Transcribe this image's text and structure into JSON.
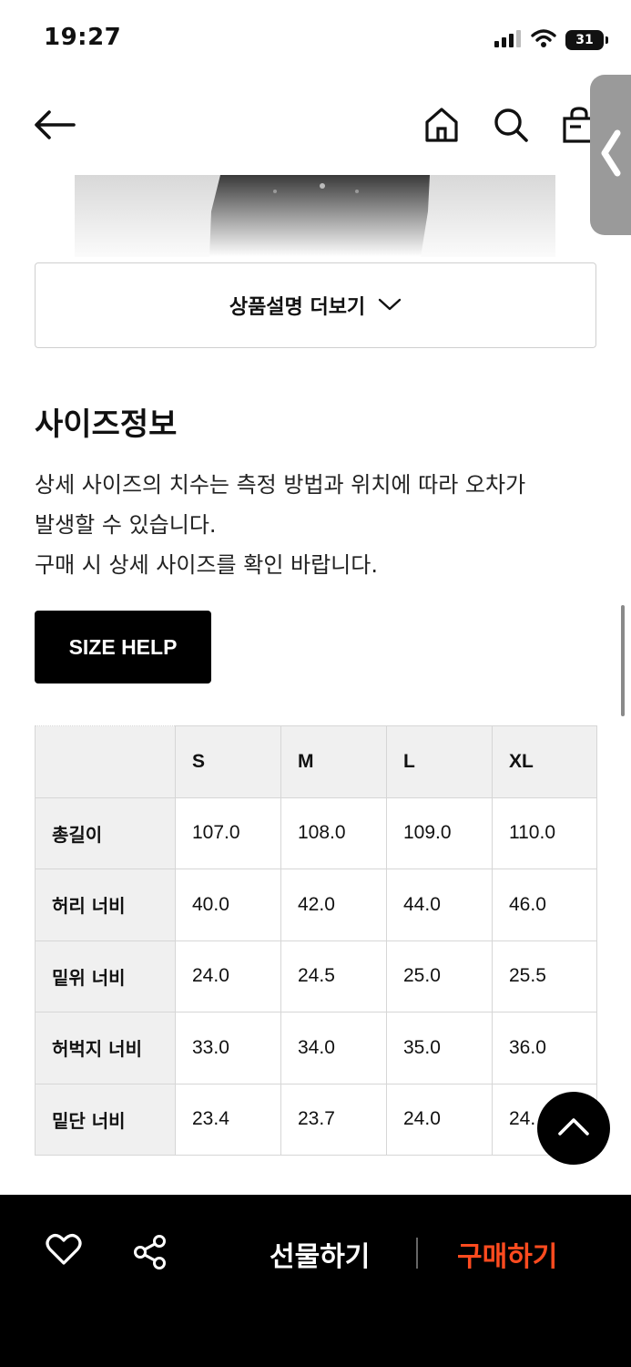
{
  "status_bar": {
    "time": "19:27",
    "battery": "31",
    "icons": [
      "signal-icon",
      "wifi-icon",
      "battery-icon"
    ]
  },
  "nav": {
    "icons": [
      "back-arrow-icon",
      "home-icon",
      "search-icon",
      "shopping-bag-icon",
      "chevron-left-icon"
    ]
  },
  "product": {
    "more_button_label": "상품설명 더보기"
  },
  "size_info": {
    "title": "사이즈정보",
    "notice_lines": [
      "상세 사이즈의 치수는 측정 방법과 위치에 따라 오차가",
      "발생할 수 있습니다.",
      "구매 시 상세 사이즈를 확인 바랍니다."
    ],
    "help_button_label": "SIZE HELP",
    "columns": [
      "",
      "S",
      "M",
      "L",
      "XL"
    ],
    "rows": [
      {
        "label": "총길이",
        "values": [
          "107.0",
          "108.0",
          "109.0",
          "110.0"
        ]
      },
      {
        "label": "허리 너비",
        "values": [
          "40.0",
          "42.0",
          "44.0",
          "46.0"
        ]
      },
      {
        "label": "밑위 너비",
        "values": [
          "24.0",
          "24.5",
          "25.0",
          "25.5"
        ]
      },
      {
        "label": "허벅지 너비",
        "values": [
          "33.0",
          "34.0",
          "35.0",
          "36.0"
        ]
      },
      {
        "label": "밑단 너비",
        "values": [
          "23.4",
          "23.7",
          "24.0",
          "24."
        ]
      }
    ]
  },
  "bottom_bar": {
    "gift_label": "선물하기",
    "buy_label": "구매하기",
    "icons": [
      "heart-icon",
      "share-icon",
      "arrow-up-icon"
    ]
  },
  "colors": {
    "buy_accent": "#ff4b1f",
    "bar_background": "#000000",
    "table_header_bg": "#f0f0f0"
  }
}
